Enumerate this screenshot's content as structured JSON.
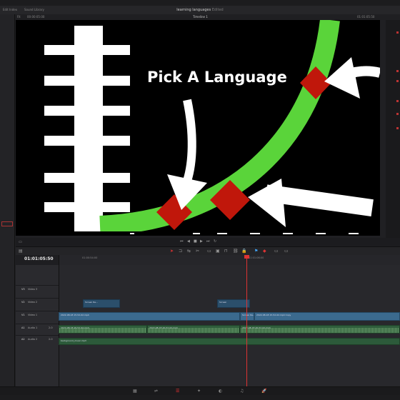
{
  "app": {
    "title": "learning languages",
    "title_status": "Edited",
    "left_tabs": [
      "Edit Index",
      "Sound Library"
    ]
  },
  "viewer": {
    "timeline_name": "Timeline 1",
    "zoom": "Fit",
    "source_timecode": "00:00:05:00",
    "right_timecode": "01:01:05:50",
    "overlay_text": "Pick A Language"
  },
  "timeline": {
    "timecode": "01:01:05:50",
    "ruler_labels": [
      "01:00:54:00",
      "01:01:06:00"
    ],
    "tracks": [
      {
        "id": "V3",
        "name": "Video 3"
      },
      {
        "id": "V2",
        "name": "Video 2"
      },
      {
        "id": "V1",
        "name": "Video 1"
      },
      {
        "id": "A1",
        "name": "Audio 1",
        "level": "2.0"
      },
      {
        "id": "A2",
        "name": "Audio 2",
        "level": "2.0"
      }
    ],
    "clip_labels": {
      "v2_a": "Screen Re…",
      "v2_b": "Screen",
      "v1_main": "2022-08-18 15-52-02.mp4",
      "v1_b": "Screen Re…",
      "v1_c": "2022-08-18 15-52-02.mp4 Copy",
      "a1_a": "2022-08-18 15-52-02.mp4",
      "a1_b": "2022-08-18 15-52-02.mp4",
      "a1_c": "2022-08-18 15-52-02.mp4",
      "a2": "background_music.mp3"
    }
  },
  "bottom_pages": [
    "media",
    "cut",
    "edit",
    "fusion",
    "color",
    "fairlight",
    "deliver"
  ],
  "colors": {
    "accent": "#dd3333",
    "green_path": "#5ad43a",
    "diamond": "#c0170b"
  }
}
